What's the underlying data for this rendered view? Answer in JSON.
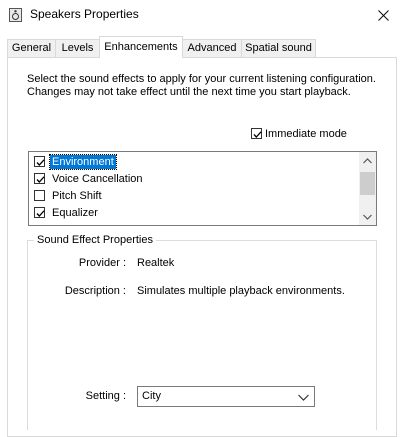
{
  "window": {
    "title": "Speakers Properties"
  },
  "tabs": [
    {
      "label": "General",
      "active": false
    },
    {
      "label": "Levels",
      "active": false
    },
    {
      "label": "Enhancements",
      "active": true
    },
    {
      "label": "Advanced",
      "active": false
    },
    {
      "label": "Spatial sound",
      "active": false
    }
  ],
  "enhancements": {
    "description": "Select the sound effects to apply for your current listening configuration. Changes may not take effect until the next time you start playback.",
    "immediate_mode": {
      "label": "Immediate mode",
      "checked": true
    },
    "effects": [
      {
        "label": "Environment",
        "checked": true,
        "selected": true
      },
      {
        "label": "Voice Cancellation",
        "checked": true,
        "selected": false
      },
      {
        "label": "Pitch Shift",
        "checked": false,
        "selected": false
      },
      {
        "label": "Equalizer",
        "checked": true,
        "selected": false
      }
    ],
    "properties": {
      "group_title": "Sound Effect Properties",
      "provider_label": "Provider :",
      "provider_value": "Realtek",
      "description_label": "Description :",
      "description_value": "Simulates multiple playback environments.",
      "setting_label": "Setting :",
      "setting_value": "City"
    }
  },
  "colors": {
    "selection": "#0078d7",
    "border": "#d9d9d9"
  }
}
